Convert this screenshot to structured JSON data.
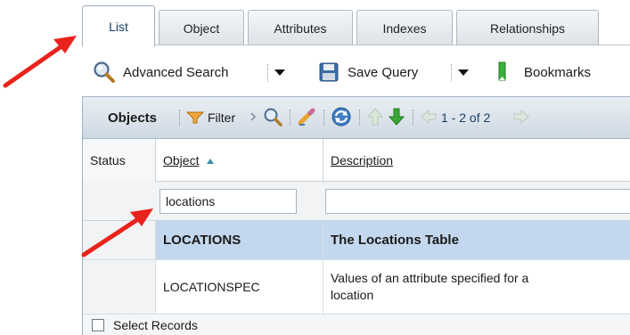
{
  "tabs": [
    {
      "label": "List",
      "active": true
    },
    {
      "label": "Object",
      "active": false
    },
    {
      "label": "Attributes",
      "active": false
    },
    {
      "label": "Indexes",
      "active": false
    },
    {
      "label": "Relationships",
      "active": false
    }
  ],
  "toolbar": {
    "advanced_search_label": "Advanced Search",
    "save_query_label": "Save Query",
    "bookmarks_label": "Bookmarks"
  },
  "gridbar": {
    "title": "Objects",
    "filter_label": "Filter",
    "pagination_text": "1 - 2 of 2"
  },
  "table": {
    "columns": [
      "Status",
      "Object",
      "Description"
    ],
    "filter": {
      "object_value": "locations",
      "description_value": ""
    },
    "rows": [
      {
        "object": "LOCATIONS",
        "description": "The Locations Table",
        "selected": true
      },
      {
        "object": "LOCATIONSPEC",
        "description_line1": "Values of an attribute specified for a",
        "description_line2": "location",
        "selected": false
      }
    ],
    "select_records_label": "Select Records"
  },
  "colors": {
    "annotation_arrow": "#e8231c",
    "selected_row": "#c3d8ee",
    "active_tab_text": "#1b3f66",
    "sort_indicator": "#3a8fa8"
  }
}
